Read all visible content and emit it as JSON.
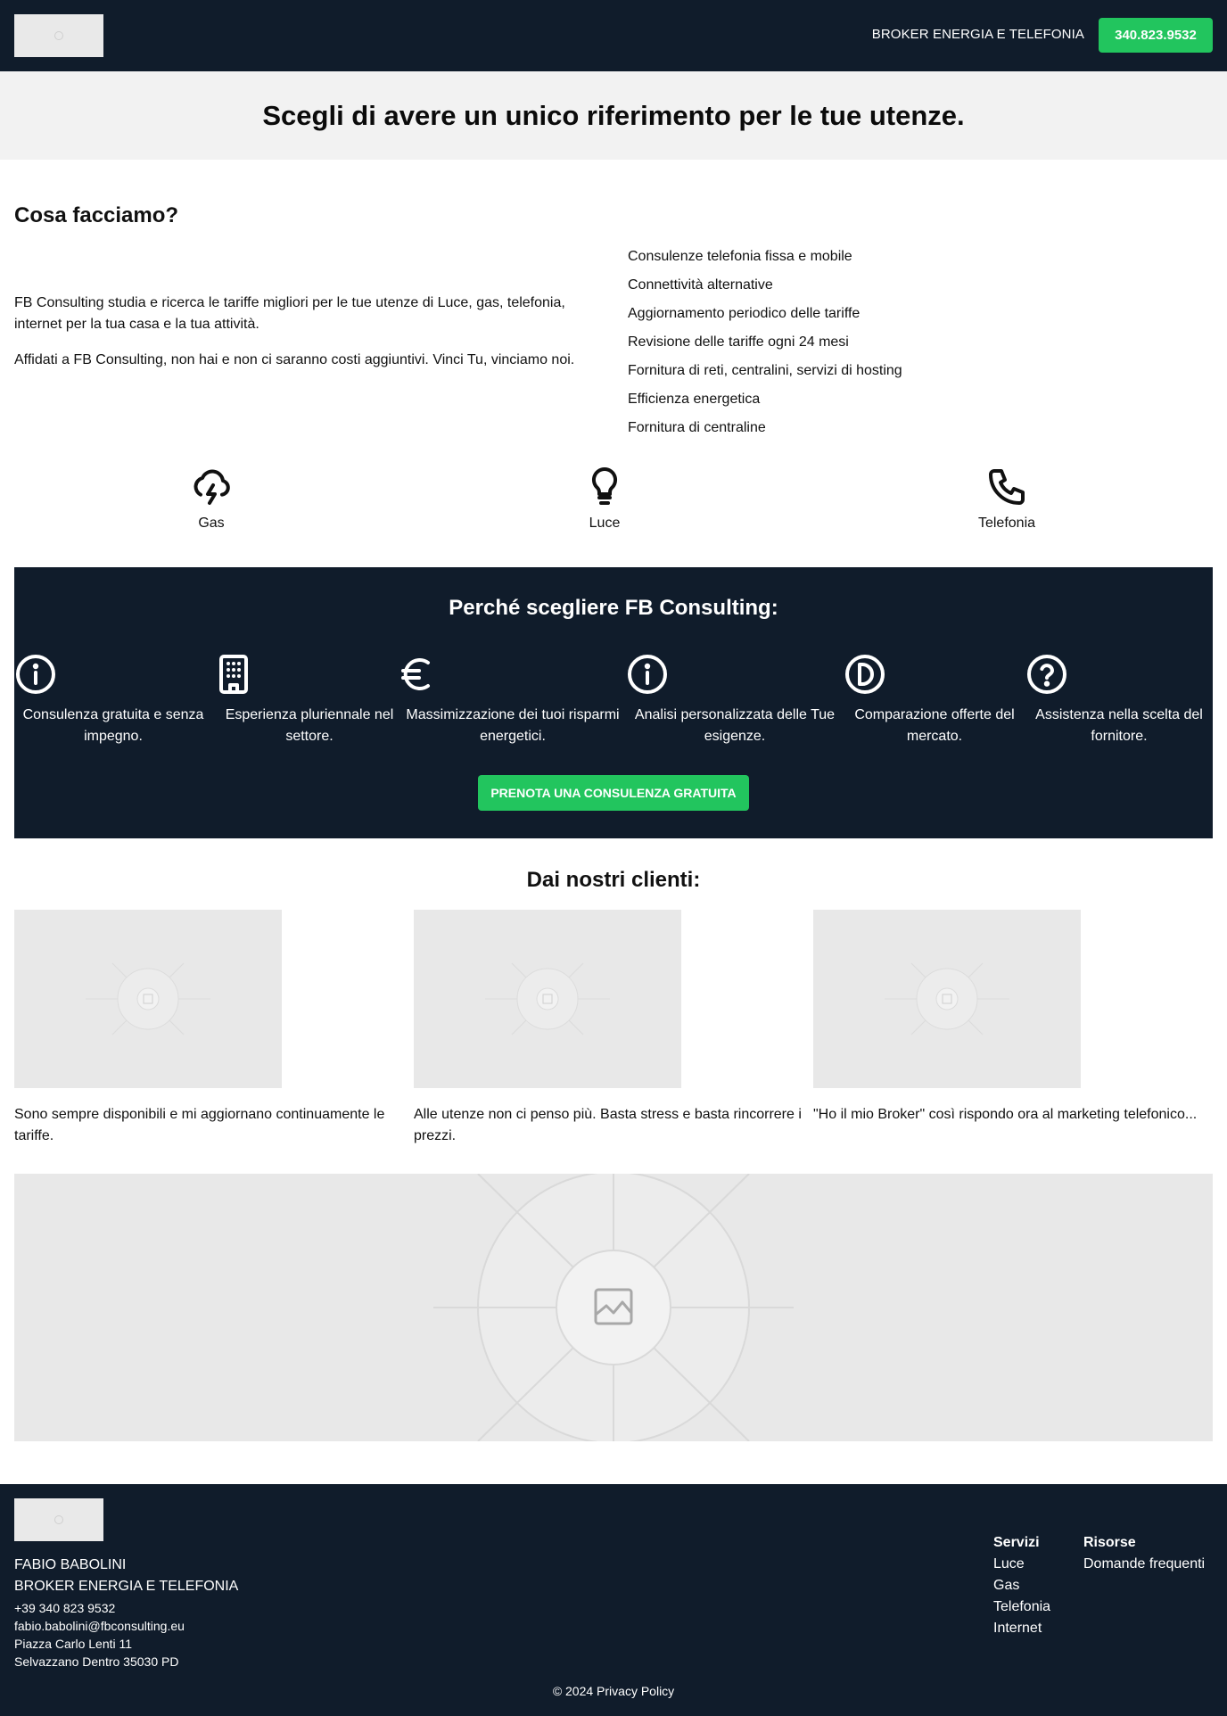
{
  "header": {
    "tagline": "BROKER ENERGIA E TELEFONIA",
    "phone_button": "340.823.9532"
  },
  "hero": {
    "title": "Scegli di avere un unico riferimento per le tue utenze."
  },
  "about": {
    "title": "Cosa facciamo?",
    "paragraphs": [
      "FB Consulting studia e ricerca le tariffe migliori per le tue utenze di Luce, gas, telefonia, internet per la tua casa e la tua attività.",
      "Affidati a FB Consulting, non hai e non ci saranno costi aggiuntivi. Vinci Tu, vinciamo noi."
    ],
    "services": [
      "Consulenze telefonia fissa e mobile",
      "Connettività alternative",
      "Aggiornamento periodico delle tariffe",
      "Revisione delle tariffe ogni 24 mesi",
      "Fornitura di reti, centralini, servizi di hosting",
      "Efficienza energetica",
      "Fornitura di centraline"
    ]
  },
  "utilities": [
    {
      "label": "Gas",
      "icon": "cloud-lightning-icon"
    },
    {
      "label": "Luce",
      "icon": "lightbulb-icon"
    },
    {
      "label": "Telefonia",
      "icon": "phone-icon"
    }
  ],
  "why": {
    "title": "Perché scegliere FB Consulting:",
    "features": [
      {
        "text": "Consulenza gratuita e senza impegno.",
        "icon": "info-icon"
      },
      {
        "text": "Esperienza pluriennale nel settore.",
        "icon": "building-icon"
      },
      {
        "text": "Massimizzazione dei tuoi risparmi energetici.",
        "icon": "euro-icon"
      },
      {
        "text": "Analisi personalizzata delle Tue esigenze.",
        "icon": "info-icon"
      },
      {
        "text": "Comparazione offerte del mercato.",
        "icon": "compare-icon"
      },
      {
        "text": "Assistenza nella scelta del fornitore.",
        "icon": "help-icon"
      }
    ],
    "cta": "PRENOTA UNA CONSULENZA GRATUITA"
  },
  "clients": {
    "title": "Dai nostri clienti:",
    "testimonials": [
      "Sono sempre disponibili e mi aggiornano continuamente le tariffe.",
      "Alle utenze non ci penso più. Basta stress e basta rincorrere i prezzi.",
      "\"Ho il mio Broker\" così rispondo ora al marketing telefonico..."
    ]
  },
  "footer": {
    "name": "FABIO BABOLINI",
    "role": "BROKER ENERGIA E TELEFONIA",
    "phone": "+39 340 823 9532",
    "email": "fabio.babolini@fbconsulting.eu",
    "address": "Piazza Carlo Lenti 11",
    "city": "Selvazzano Dentro 35030 PD",
    "servizi_title": "Servizi",
    "servizi": [
      "Luce",
      "Gas",
      "Telefonia",
      "Internet"
    ],
    "risorse_title": "Risorse",
    "risorse": [
      "Domande frequenti"
    ],
    "copyright": "© 2024 Privacy Policy"
  },
  "colors": {
    "navy": "#101c2b",
    "green": "#22c55e",
    "hero_bg": "#f2f2f2",
    "placeholder": "#e8e8e8"
  }
}
